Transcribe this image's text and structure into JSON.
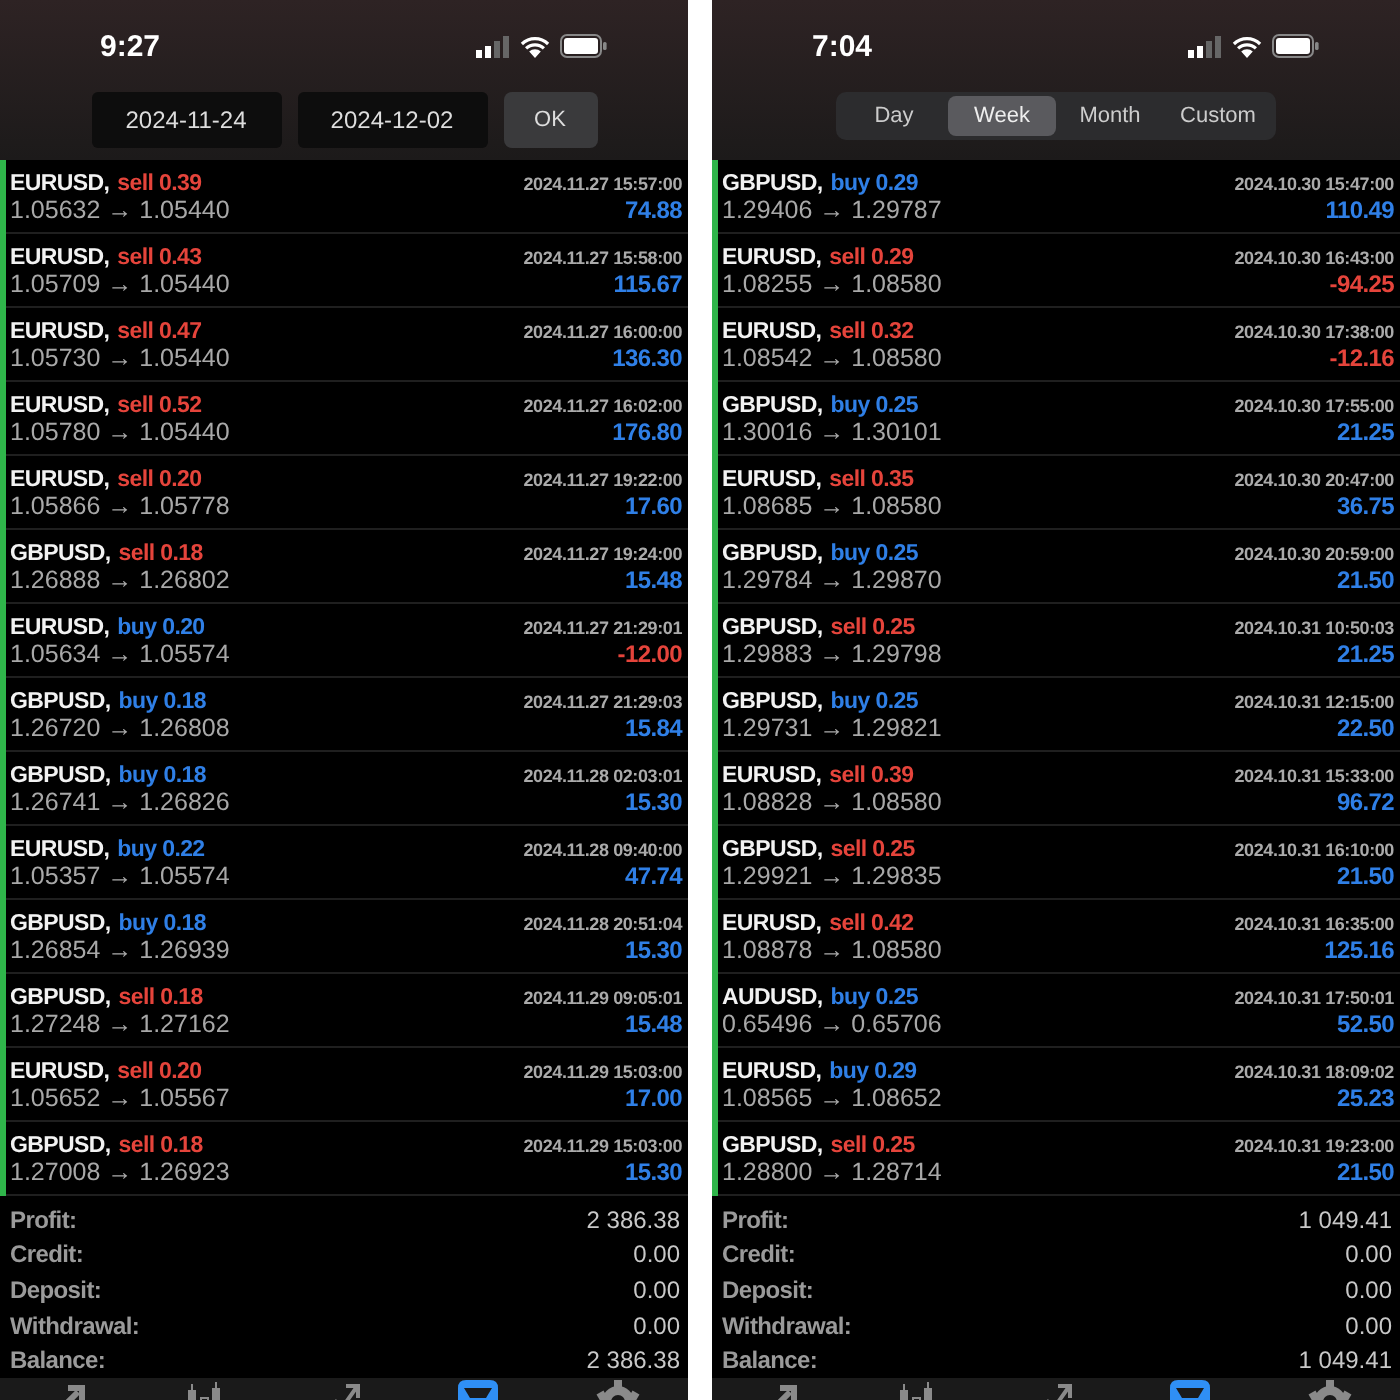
{
  "panels": [
    {
      "status_bar": {
        "time": "9:27"
      },
      "header": {
        "kind": "date_range",
        "from": "2024-11-24",
        "to": "2024-12-02",
        "button": "OK"
      },
      "trades": [
        {
          "symbol": "EURUSD,",
          "order": "sell 0.39",
          "kind": "sell",
          "time": "2024.11.27 15:57:00",
          "prices": "1.05632 → 1.05440",
          "profit": "74.88",
          "loss": false
        },
        {
          "symbol": "EURUSD,",
          "order": "sell 0.43",
          "kind": "sell",
          "time": "2024.11.27 15:58:00",
          "prices": "1.05709 → 1.05440",
          "profit": "115.67",
          "loss": false
        },
        {
          "symbol": "EURUSD,",
          "order": "sell 0.47",
          "kind": "sell",
          "time": "2024.11.27 16:00:00",
          "prices": "1.05730 → 1.05440",
          "profit": "136.30",
          "loss": false
        },
        {
          "symbol": "EURUSD,",
          "order": "sell 0.52",
          "kind": "sell",
          "time": "2024.11.27 16:02:00",
          "prices": "1.05780 → 1.05440",
          "profit": "176.80",
          "loss": false
        },
        {
          "symbol": "EURUSD,",
          "order": "sell 0.20",
          "kind": "sell",
          "time": "2024.11.27 19:22:00",
          "prices": "1.05866 → 1.05778",
          "profit": "17.60",
          "loss": false
        },
        {
          "symbol": "GBPUSD,",
          "order": "sell 0.18",
          "kind": "sell",
          "time": "2024.11.27 19:24:00",
          "prices": "1.26888 → 1.26802",
          "profit": "15.48",
          "loss": false
        },
        {
          "symbol": "EURUSD,",
          "order": "buy 0.20",
          "kind": "buy",
          "time": "2024.11.27 21:29:01",
          "prices": "1.05634 → 1.05574",
          "profit": "-12.00",
          "loss": true
        },
        {
          "symbol": "GBPUSD,",
          "order": "buy 0.18",
          "kind": "buy",
          "time": "2024.11.27 21:29:03",
          "prices": "1.26720 → 1.26808",
          "profit": "15.84",
          "loss": false
        },
        {
          "symbol": "GBPUSD,",
          "order": "buy 0.18",
          "kind": "buy",
          "time": "2024.11.28 02:03:01",
          "prices": "1.26741 → 1.26826",
          "profit": "15.30",
          "loss": false
        },
        {
          "symbol": "EURUSD,",
          "order": "buy 0.22",
          "kind": "buy",
          "time": "2024.11.28 09:40:00",
          "prices": "1.05357 → 1.05574",
          "profit": "47.74",
          "loss": false
        },
        {
          "symbol": "GBPUSD,",
          "order": "buy 0.18",
          "kind": "buy",
          "time": "2024.11.28 20:51:04",
          "prices": "1.26854 → 1.26939",
          "profit": "15.30",
          "loss": false
        },
        {
          "symbol": "GBPUSD,",
          "order": "sell 0.18",
          "kind": "sell",
          "time": "2024.11.29 09:05:01",
          "prices": "1.27248 → 1.27162",
          "profit": "15.48",
          "loss": false
        },
        {
          "symbol": "EURUSD,",
          "order": "sell 0.20",
          "kind": "sell",
          "time": "2024.11.29 15:03:00",
          "prices": "1.05652 → 1.05567",
          "profit": "17.00",
          "loss": false
        },
        {
          "symbol": "GBPUSD,",
          "order": "sell 0.18",
          "kind": "sell",
          "time": "2024.11.29 15:03:00",
          "prices": "1.27008 → 1.26923",
          "profit": "15.30",
          "loss": false
        }
      ],
      "summary": [
        {
          "label": "Profit:",
          "value": "2 386.38"
        },
        {
          "label": "Credit:",
          "value": "0.00"
        },
        {
          "label": "Deposit:",
          "value": "0.00"
        },
        {
          "label": "Withdrawal:",
          "value": "0.00"
        },
        {
          "label": "Balance:",
          "value": "2 386.38"
        }
      ],
      "tab_bar": [
        {
          "selected": false
        },
        {
          "selected": false
        },
        {
          "selected": false
        },
        {
          "selected": true
        },
        {
          "selected": false
        }
      ]
    },
    {
      "status_bar": {
        "time": "7:04"
      },
      "header": {
        "kind": "periods",
        "options": [
          {
            "label": "Day",
            "selected": false
          },
          {
            "label": "Week",
            "selected": true
          },
          {
            "label": "Month",
            "selected": false
          },
          {
            "label": "Custom",
            "selected": false
          }
        ]
      },
      "trades": [
        {
          "symbol": "GBPUSD,",
          "order": "buy 0.29",
          "kind": "buy",
          "time": "2024.10.30 15:47:00",
          "prices": "1.29406 → 1.29787",
          "profit": "110.49",
          "loss": false
        },
        {
          "symbol": "EURUSD,",
          "order": "sell 0.29",
          "kind": "sell",
          "time": "2024.10.30 16:43:00",
          "prices": "1.08255 → 1.08580",
          "profit": "-94.25",
          "loss": true
        },
        {
          "symbol": "EURUSD,",
          "order": "sell 0.32",
          "kind": "sell",
          "time": "2024.10.30 17:38:00",
          "prices": "1.08542 → 1.08580",
          "profit": "-12.16",
          "loss": true
        },
        {
          "symbol": "GBPUSD,",
          "order": "buy 0.25",
          "kind": "buy",
          "time": "2024.10.30 17:55:00",
          "prices": "1.30016 → 1.30101",
          "profit": "21.25",
          "loss": false
        },
        {
          "symbol": "EURUSD,",
          "order": "sell 0.35",
          "kind": "sell",
          "time": "2024.10.30 20:47:00",
          "prices": "1.08685 → 1.08580",
          "profit": "36.75",
          "loss": false
        },
        {
          "symbol": "GBPUSD,",
          "order": "buy 0.25",
          "kind": "buy",
          "time": "2024.10.30 20:59:00",
          "prices": "1.29784 → 1.29870",
          "profit": "21.50",
          "loss": false
        },
        {
          "symbol": "GBPUSD,",
          "order": "sell 0.25",
          "kind": "sell",
          "time": "2024.10.31 10:50:03",
          "prices": "1.29883 → 1.29798",
          "profit": "21.25",
          "loss": false
        },
        {
          "symbol": "GBPUSD,",
          "order": "buy 0.25",
          "kind": "buy",
          "time": "2024.10.31 12:15:00",
          "prices": "1.29731 → 1.29821",
          "profit": "22.50",
          "loss": false
        },
        {
          "symbol": "EURUSD,",
          "order": "sell 0.39",
          "kind": "sell",
          "time": "2024.10.31 15:33:00",
          "prices": "1.08828 → 1.08580",
          "profit": "96.72",
          "loss": false
        },
        {
          "symbol": "GBPUSD,",
          "order": "sell 0.25",
          "kind": "sell",
          "time": "2024.10.31 16:10:00",
          "prices": "1.29921 → 1.29835",
          "profit": "21.50",
          "loss": false
        },
        {
          "symbol": "EURUSD,",
          "order": "sell 0.42",
          "kind": "sell",
          "time": "2024.10.31 16:35:00",
          "prices": "1.08878 → 1.08580",
          "profit": "125.16",
          "loss": false
        },
        {
          "symbol": "AUDUSD,",
          "order": "buy 0.25",
          "kind": "buy",
          "time": "2024.10.31 17:50:01",
          "prices": "0.65496 → 0.65706",
          "profit": "52.50",
          "loss": false
        },
        {
          "symbol": "EURUSD,",
          "order": "buy 0.29",
          "kind": "buy",
          "time": "2024.10.31 18:09:02",
          "prices": "1.08565 → 1.08652",
          "profit": "25.23",
          "loss": false
        },
        {
          "symbol": "GBPUSD,",
          "order": "sell 0.25",
          "kind": "sell",
          "time": "2024.10.31 19:23:00",
          "prices": "1.28800 → 1.28714",
          "profit": "21.50",
          "loss": false
        }
      ],
      "summary": [
        {
          "label": "Profit:",
          "value": "1 049.41"
        },
        {
          "label": "Credit:",
          "value": "0.00"
        },
        {
          "label": "Deposit:",
          "value": "0.00"
        },
        {
          "label": "Withdrawal:",
          "value": "0.00"
        },
        {
          "label": "Balance:",
          "value": "1 049.41"
        }
      ],
      "tab_bar": [
        {
          "selected": false
        },
        {
          "selected": false
        },
        {
          "selected": false
        },
        {
          "selected": true
        },
        {
          "selected": false
        }
      ]
    }
  ]
}
